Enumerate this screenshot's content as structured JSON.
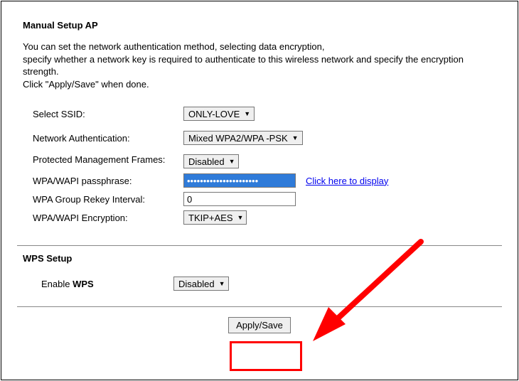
{
  "title": "Manual Setup AP",
  "intro_line1": "You can set the network authentication method, selecting data encryption,",
  "intro_line2": "specify whether a network key is required to authenticate to this wireless network and specify the encryption strength.",
  "intro_line3": "Click \"Apply/Save\" when done.",
  "fields": {
    "ssid": {
      "label": "Select SSID:",
      "value": "ONLY-LOVE"
    },
    "auth": {
      "label": "Network Authentication:",
      "value": "Mixed WPA2/WPA -PSK"
    },
    "pmf": {
      "label": "Protected Management Frames:",
      "value": "Disabled"
    },
    "pass": {
      "label": "WPA/WAPI passphrase:",
      "value": "••••••••••••••••••••••",
      "link": "Click here to display"
    },
    "rekey": {
      "label": "WPA Group Rekey Interval:",
      "value": "0"
    },
    "enc": {
      "label": "WPA/WAPI Encryption:",
      "value": "TKIP+AES"
    }
  },
  "wps": {
    "title": "WPS Setup",
    "label_prefix": "Enable ",
    "label_bold": "WPS",
    "value": "Disabled"
  },
  "apply_label": "Apply/Save",
  "annotation": {
    "color": "#ff0000"
  }
}
